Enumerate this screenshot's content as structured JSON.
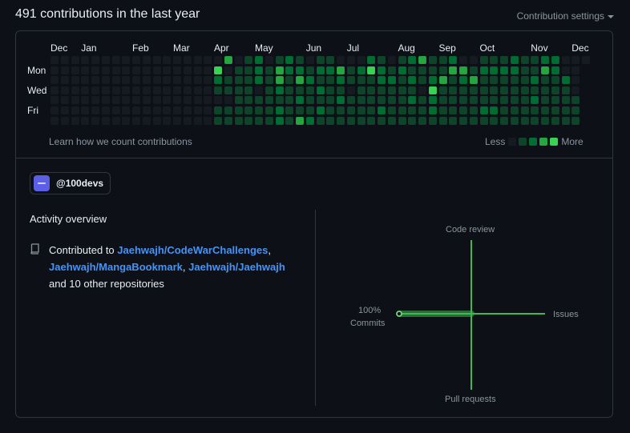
{
  "header": {
    "title": "491 contributions in the last year",
    "settings_label": "Contribution settings"
  },
  "calendar": {
    "months": [
      "Dec",
      "Jan",
      "Feb",
      "Mar",
      "Apr",
      "May",
      "Jun",
      "Jul",
      "Aug",
      "Sep",
      "Oct",
      "Nov",
      "Dec"
    ],
    "month_start_week": [
      0,
      3,
      8,
      12,
      16,
      20,
      25,
      29,
      34,
      38,
      42,
      47,
      51
    ],
    "day_labels": [
      "Mon",
      "Wed",
      "Fri"
    ],
    "day_label_rows": [
      1,
      3,
      5
    ],
    "weeks": 53,
    "first_active_week": 16,
    "levels": [
      "0000000000000000030120121011000210123112001112112200",
      "0000000000000000401121322122312421211113312222113200",
      "0000000000000000211121313211211122121231231111121120",
      "0000000000000000111101211121101111110411111111111110",
      "0000000000000000001111112111211111121211111111121111",
      "0000000000000000111111211121111121111211112211111111",
      "0000000000000000111111213211111111111111111111111111"
    ],
    "learn_label": "Learn how we count contributions",
    "legend_less": "Less",
    "legend_more": "More"
  },
  "colors": {
    "level_0": "#161b22",
    "level_1": "#0e4429",
    "level_2": "#006d32",
    "level_3": "#26a641",
    "level_4": "#39d353",
    "accent_link": "#4493f8",
    "radar_line": "#3fb950"
  },
  "organization": {
    "name": "@100devs"
  },
  "activity": {
    "title": "Activity overview",
    "prefix": "Contributed to ",
    "repos": [
      "Jaehwajh/CodeWarChallenges",
      "Jaehwajh/MangaBookmark",
      "Jaehwajh/Jaehwajh"
    ],
    "sep1": ",",
    "sep2": ",",
    "suffix": " and 10 other repositories"
  },
  "overview_chart": {
    "axes": {
      "top": "Code review",
      "right": "Issues",
      "bottom": "Pull requests",
      "left_pct": "100%",
      "left": "Commits"
    },
    "values": {
      "commits": 100,
      "issues": 0,
      "pull_requests": 0,
      "code_review": 0
    }
  }
}
